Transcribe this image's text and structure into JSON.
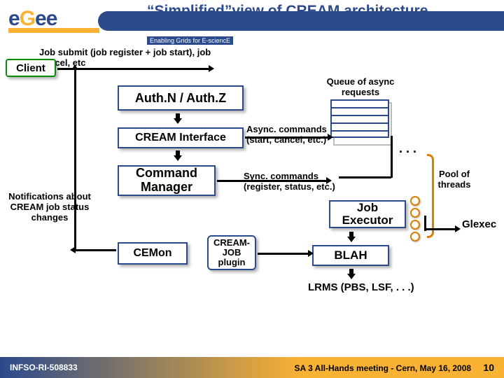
{
  "header": {
    "title": "“Simplified”view of CREAM architecture",
    "subtitle": "Enabling Grids for E-sciencE",
    "logo": {
      "letters": [
        "e",
        "G",
        "e",
        "e"
      ]
    }
  },
  "diagram": {
    "client": "Client",
    "jobsubmit": "Job submit (job register + job start), job cancel, etc",
    "authn": "Auth.N / Auth.Z",
    "cream_iface": "CREAM Interface",
    "cmd_mgr": "Command Manager",
    "cemon": "CEMon",
    "plugin": "CREAM-JOB plugin",
    "job_exec": "Job Executor",
    "blah": "BLAH",
    "queue_label": "Queue of async requests",
    "async_label": "Async. commands (start, cancel, etc.)",
    "sync_label": "Sync. commands (register, status, etc.)",
    "pool_label": "Pool of threads",
    "glexec": "Glexec",
    "lrms": "LRMS (PBS, LSF, . . .)",
    "notif": "Notifications about CREAM job status changes",
    "dots": ". . ."
  },
  "footer": {
    "left": "INFSO-RI-508833",
    "right": "SA 3 All-Hands meeting - Cern, May 16, 2008",
    "page": "10"
  }
}
